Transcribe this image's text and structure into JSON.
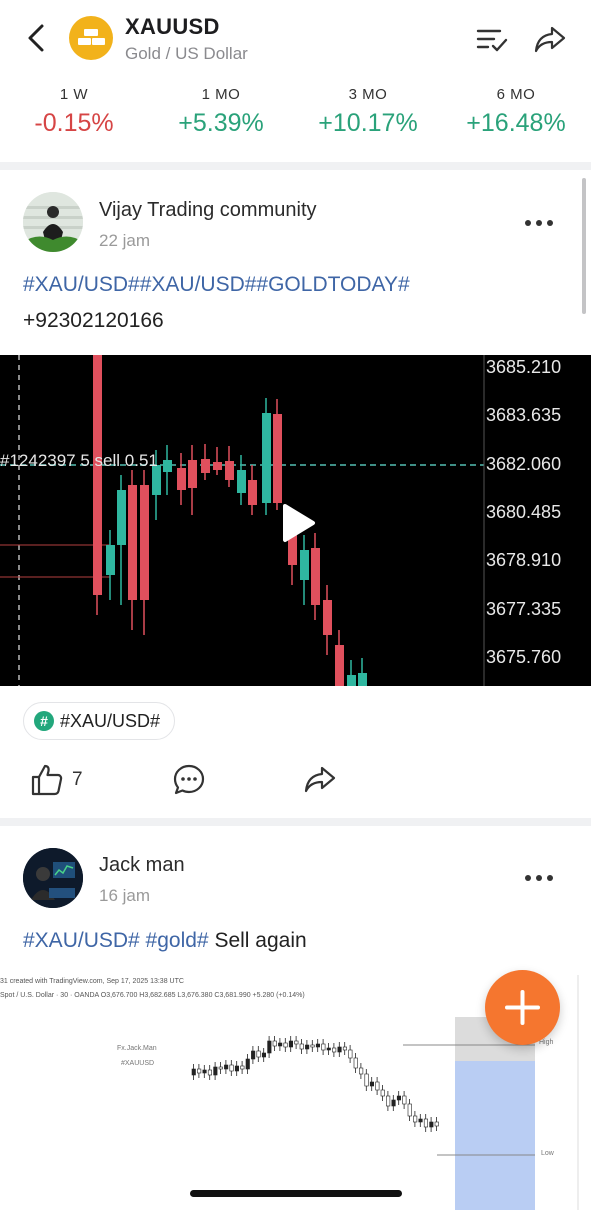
{
  "header": {
    "title": "XAUUSD",
    "subtitle": "Gold / US Dollar",
    "icons": {
      "back": "chevron-left-icon",
      "logo": "gold-bars-icon",
      "list": "list-check-icon",
      "share": "share-arrow-icon"
    }
  },
  "performance": [
    {
      "label": "1 W",
      "value": "-0.15%",
      "trend": "negative"
    },
    {
      "label": "1 MO",
      "value": "+5.39%",
      "trend": "positive"
    },
    {
      "label": "3 MO",
      "value": "+10.17%",
      "trend": "positive"
    },
    {
      "label": "6 MO",
      "value": "+16.48%",
      "trend": "positive"
    }
  ],
  "colors": {
    "negative": "#d64545",
    "positive": "#2aa27a",
    "link": "#3f66a6",
    "fab": "#f5762f"
  },
  "posts": [
    {
      "author": "Vijay Trading community",
      "time": "22 jam",
      "text_tags": "#XAU/USD##XAU/USD##GOLDTODAY#",
      "text_body": "+92302120166",
      "video": {
        "price_levels": [
          "3685.210",
          "3683.635",
          "3682.060",
          "3680.485",
          "3678.910",
          "3677.335",
          "3675.760"
        ],
        "order_label": "#1242397 5 sell 0.51"
      },
      "topic_chip": "#XAU/USD#",
      "like_count": "7"
    },
    {
      "author": "Jack man",
      "time": "16 jam",
      "text_tags": "#XAU/USD# #gold#",
      "text_body": "Sell again",
      "image": {
        "source_line": "31 created with TradingView.com, Sep 17, 2025 13:38 UTC",
        "symbol_line": "Spot / U.S. Dollar · 30 · OANDA  O3,676.700 H3,682.685 L3,676.380 C3,681.990 +5.280 (+0.14%)",
        "watermark_1": "Fx.Jack.Man",
        "watermark_2": "#XAUUSD",
        "label_high": "High",
        "label_low": "Low"
      }
    }
  ]
}
